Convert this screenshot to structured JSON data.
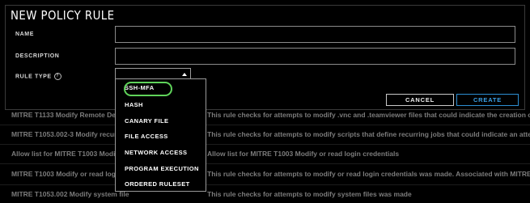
{
  "modal": {
    "title": "NEW POLICY RULE",
    "name_label": "NAME",
    "name_value": "",
    "description_label": "DESCRIPTION",
    "description_value": "",
    "rule_type_label": "RULE TYPE",
    "rule_type_help_icon": "?",
    "rule_type_selected": "",
    "cancel_label": "CANCEL",
    "create_label": "CREATE",
    "accent_color": "#2d8fd3",
    "highlight_color": "#5fd35a"
  },
  "dropdown": {
    "options": [
      "SSH-MFA",
      "HASH",
      "CANARY FILE",
      "FILE ACCESS",
      "NETWORK ACCESS",
      "PROGRAM EXECUTION",
      "ORDERED RULESET"
    ]
  },
  "background_rows": [
    {
      "name": "MITRE T1133 Modify Remote Desk",
      "desc": "This rule checks for attempts to modify .vnc and .teamviewer files that could indicate the creation of a backd"
    },
    {
      "name": "MITRE T1053.002-3 Modify recurri",
      "desc": "This rule checks for attempts to modify scripts that define recurring jobs that could indicate an attempt to ga"
    },
    {
      "name": "Allow list for MITRE T1003 Modify",
      "desc": "Allow list for MITRE T1003 Modify or read login credentials"
    },
    {
      "name": "MITRE T1003 Modify or read login",
      "desc": "This rule checks for attempts to modify or read login credentials was made. Associated with MITRE techniqu"
    },
    {
      "name": "MITRE T1053.002 Modify system file",
      "desc": "This rule checks for attempts to modify system files was made"
    }
  ]
}
